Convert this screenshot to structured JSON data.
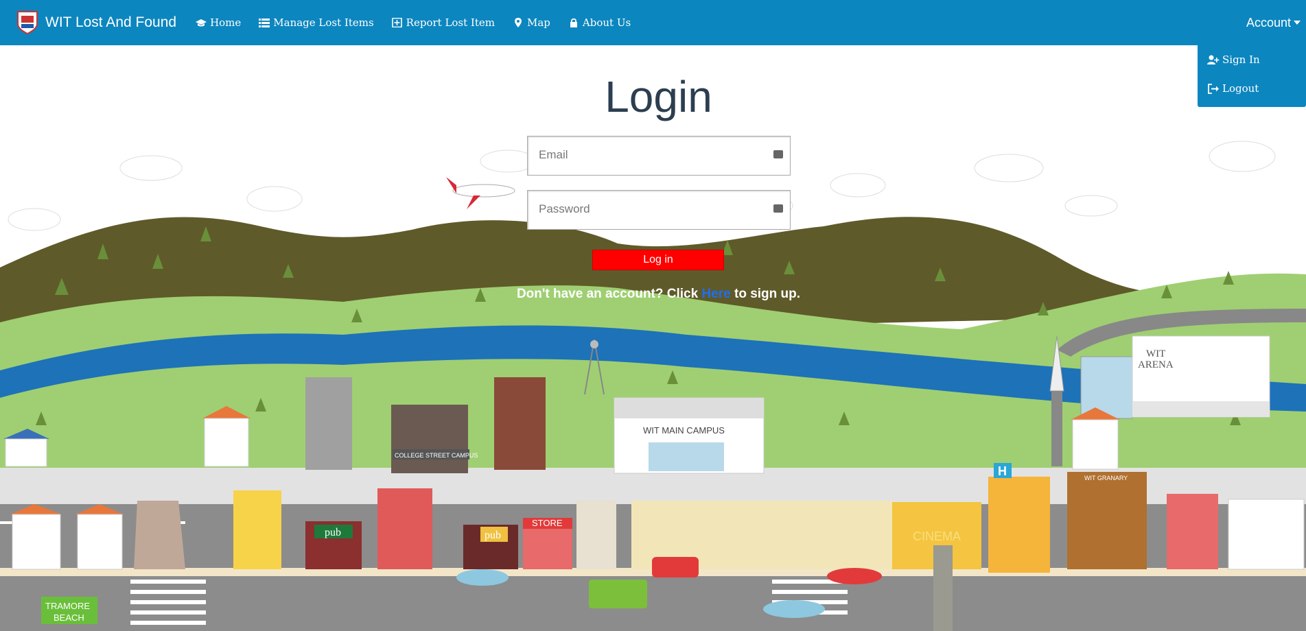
{
  "navbar": {
    "brand": "WIT Lost And Found",
    "items": [
      {
        "label": "Home",
        "icon": "graduation-cap-icon"
      },
      {
        "label": "Manage Lost Items",
        "icon": "list-icon"
      },
      {
        "label": "Report Lost Item",
        "icon": "plus-square-icon"
      },
      {
        "label": "Map",
        "icon": "map-marker-icon"
      },
      {
        "label": "About Us",
        "icon": "lock-icon"
      }
    ],
    "account_label": "Account"
  },
  "account_dropdown": {
    "items": [
      {
        "label": "Sign In",
        "icon": "user-plus-icon"
      },
      {
        "label": "Logout",
        "icon": "sign-out-icon"
      }
    ]
  },
  "login": {
    "title": "Login",
    "email_placeholder": "Email",
    "password_placeholder": "Password",
    "button_label": "Log in",
    "signup_prefix": "Don't have an account? Click ",
    "signup_link": "Here",
    "signup_suffix": " to sign up."
  },
  "scene": {
    "labels": {
      "arena": "WIT\nARENA",
      "main_campus": "WIT MAIN CAMPUS",
      "college_street": "COLLEGE STREET CAMPUS",
      "granary": "WIT GRANARY",
      "cinema": "CINEMA",
      "pub1": "pub",
      "pub2": "pub",
      "store": "STORE",
      "tramore": "TRAMORE\nBEACH",
      "hospital": "H"
    }
  },
  "colors": {
    "navbar": "#0c86bf",
    "title": "#2c3e50",
    "login_button": "#ff0000",
    "signup_link": "#1e6ff0",
    "hills_dark": "#5f5a2a",
    "grass": "#9fcf72",
    "river": "#1e72b8",
    "road": "#8c8c8c"
  }
}
